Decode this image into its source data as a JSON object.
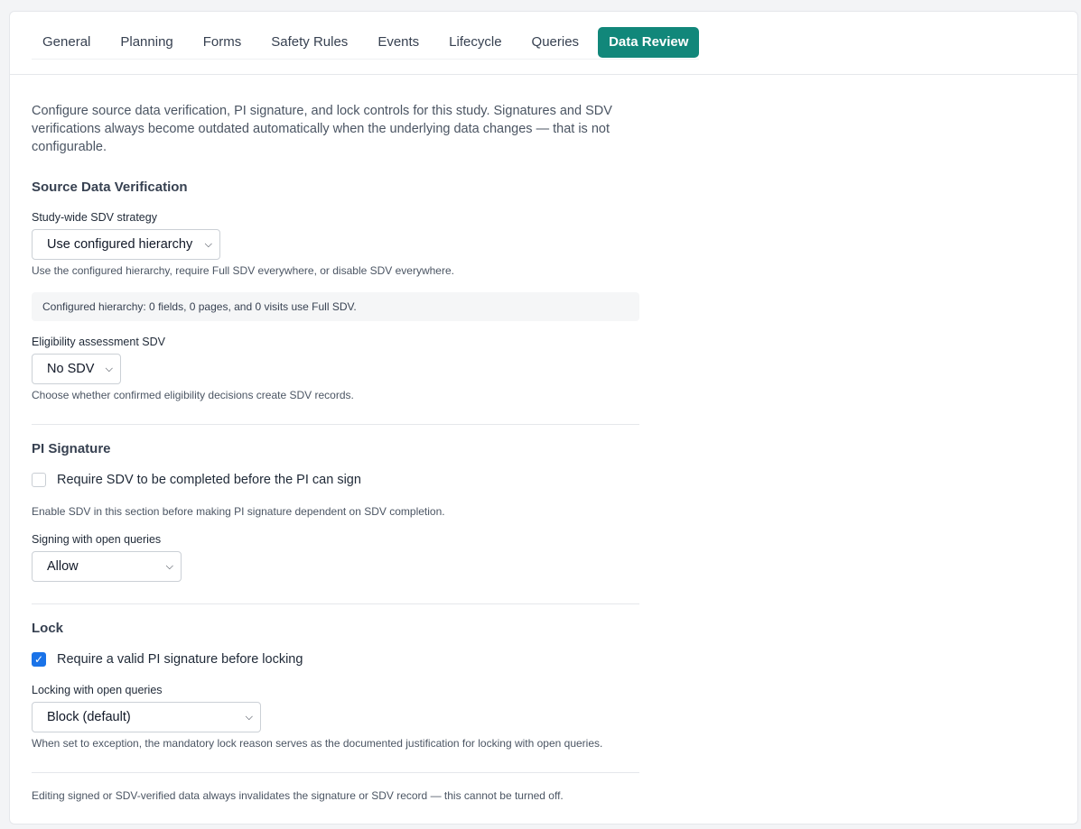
{
  "tabs": [
    {
      "label": "General",
      "active": false
    },
    {
      "label": "Planning",
      "active": false
    },
    {
      "label": "Forms",
      "active": false
    },
    {
      "label": "Safety Rules",
      "active": false
    },
    {
      "label": "Events",
      "active": false
    },
    {
      "label": "Lifecycle",
      "active": false
    },
    {
      "label": "Queries",
      "active": false
    },
    {
      "label": "Data Review",
      "active": true
    }
  ],
  "intro": "Configure source data verification, PI signature, and lock controls for this study. Signatures and SDV verifications always become outdated automatically when the underlying data changes — that is not configurable.",
  "sdv": {
    "heading": "Source Data Verification",
    "strategy_label": "Study-wide SDV strategy",
    "strategy_value": "Use configured hierarchy",
    "strategy_help": "Use the configured hierarchy, require Full SDV everywhere, or disable SDV everywhere.",
    "hierarchy_info": "Configured hierarchy: 0 fields, 0 pages, and 0 visits use Full SDV.",
    "eligibility_label": "Eligibility assessment SDV",
    "eligibility_value": "No SDV",
    "eligibility_help": "Choose whether confirmed eligibility decisions create SDV records."
  },
  "pi": {
    "heading": "PI Signature",
    "require_sdv_label": "Require SDV to be completed before the PI can sign",
    "require_sdv_checked": false,
    "require_sdv_help": "Enable SDV in this section before making PI signature dependent on SDV completion.",
    "open_queries_label": "Signing with open queries",
    "open_queries_value": "Allow"
  },
  "lock": {
    "heading": "Lock",
    "require_sig_label": "Require a valid PI signature before locking",
    "require_sig_checked": true,
    "open_queries_label": "Locking with open queries",
    "open_queries_value": "Block (default)",
    "open_queries_help": "When set to exception, the mandatory lock reason serves as the documented justification for locking with open queries."
  },
  "footer_note": "Editing signed or SDV-verified data always invalidates the signature or SDV record — this cannot be turned off.",
  "colors": {
    "accent": "#11877a",
    "checkbox": "#1a73e8"
  }
}
